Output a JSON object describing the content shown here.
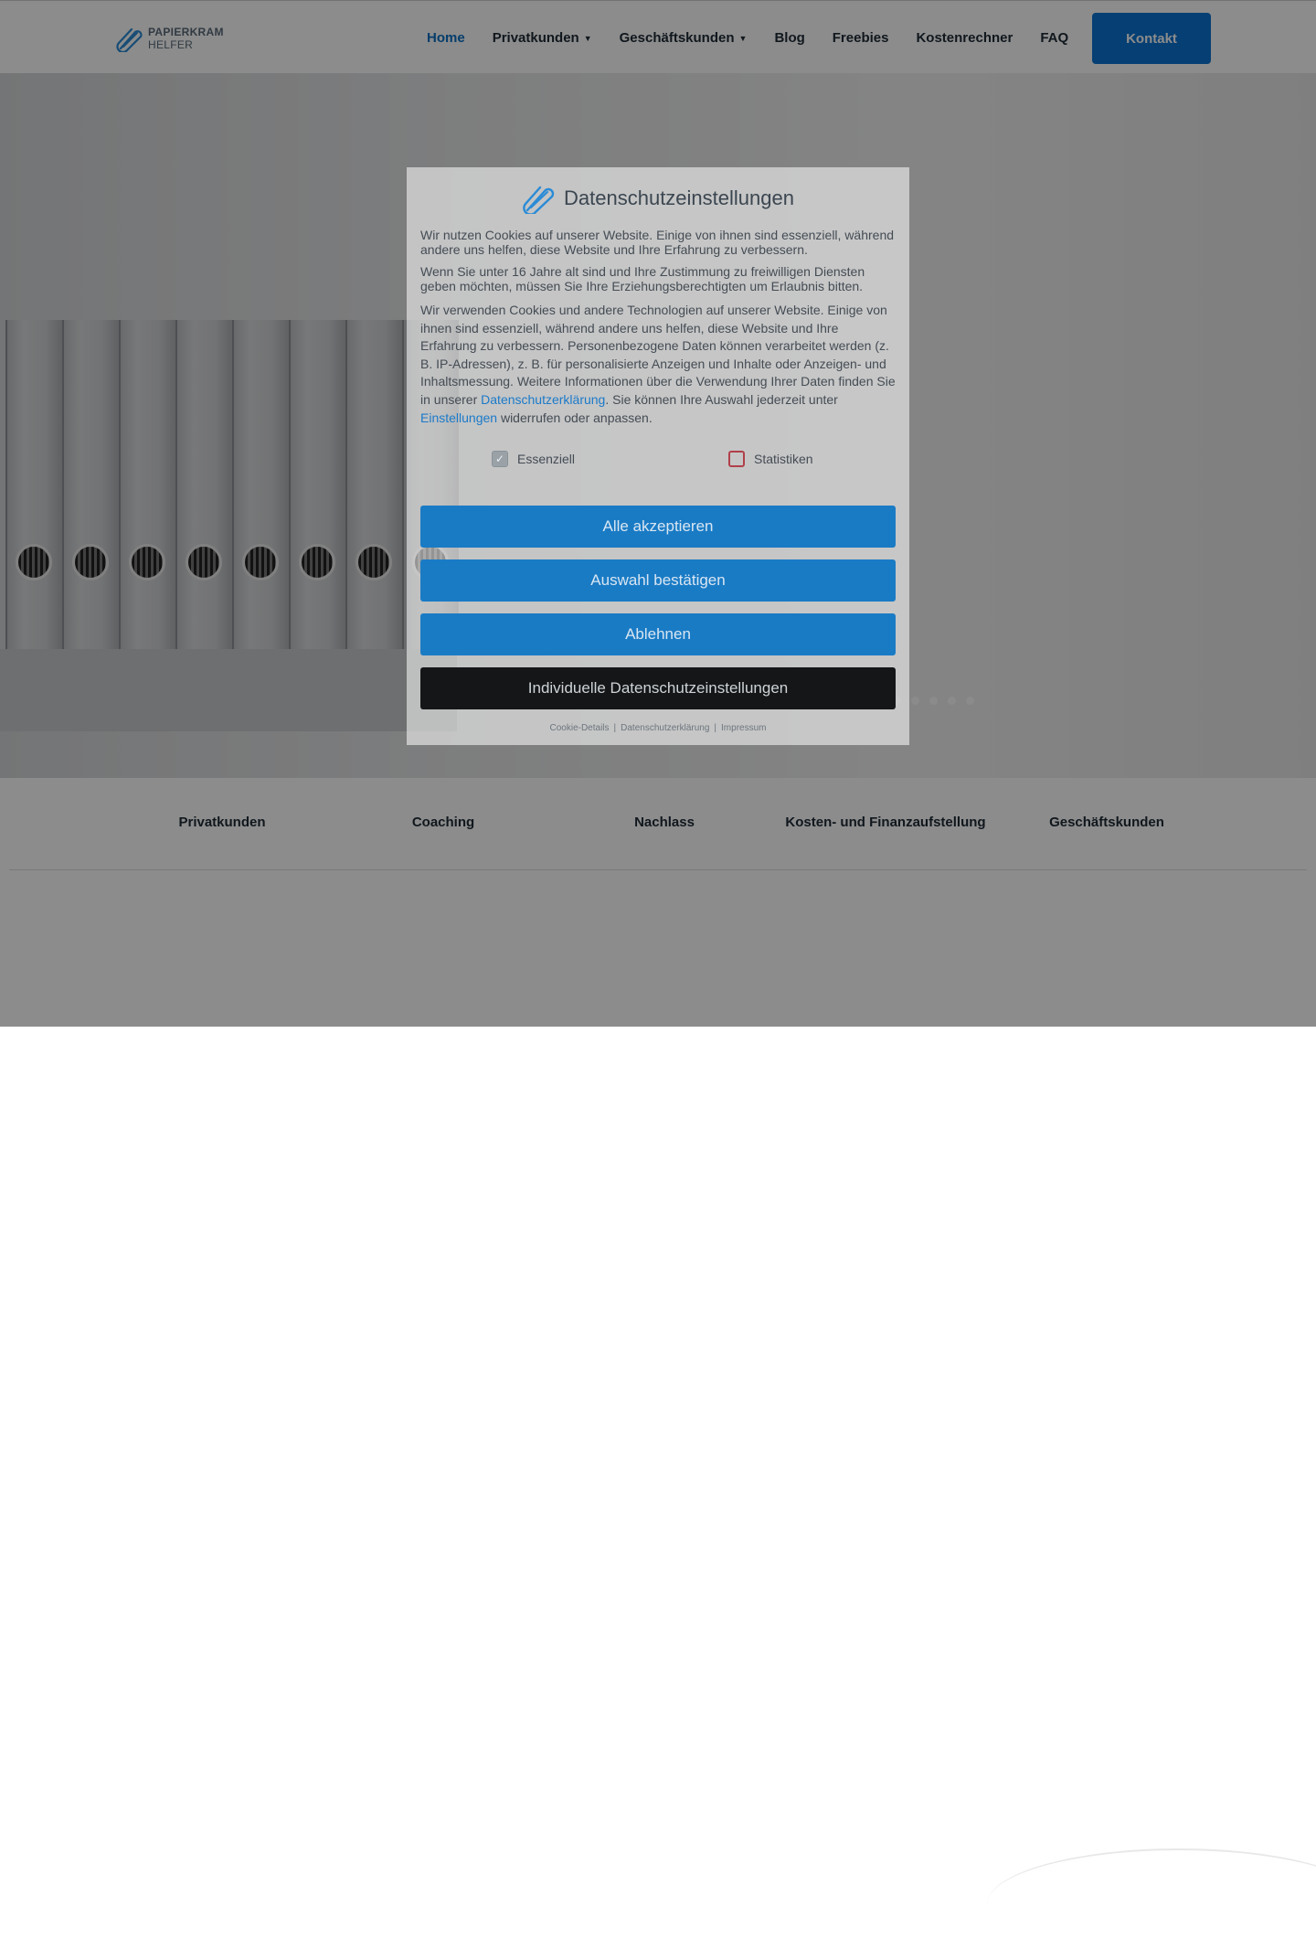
{
  "header": {
    "logo_line1": "PAPIERKRAM",
    "logo_line2": "HELFER",
    "nav": [
      {
        "label": "Home",
        "active": true,
        "dropdown": false
      },
      {
        "label": "Privatkunden",
        "active": false,
        "dropdown": true
      },
      {
        "label": "Geschäftskunden",
        "active": false,
        "dropdown": true
      },
      {
        "label": "Blog",
        "active": false,
        "dropdown": false
      },
      {
        "label": "Freebies",
        "active": false,
        "dropdown": false
      },
      {
        "label": "Kostenrechner",
        "active": false,
        "dropdown": false
      },
      {
        "label": "FAQ",
        "active": false,
        "dropdown": false
      }
    ],
    "cta": "Kontakt"
  },
  "hero": {
    "slides": 6,
    "active_slide": 1
  },
  "categories": [
    "Privatkunden",
    "Coaching",
    "Nachlass",
    "Kosten- und Finanzaufstellung",
    "Geschäftskunden"
  ],
  "cookie": {
    "title": "Datenschutzeinstellungen",
    "p1": "Wir nutzen Cookies auf unserer Website. Einige von ihnen sind essenziell, während andere uns helfen, diese Website und Ihre Erfahrung zu verbessern.",
    "p2": "Wenn Sie unter 16 Jahre alt sind und Ihre Zustimmung zu freiwilligen Diensten geben möchten, müssen Sie Ihre Erziehungsberechtigten um Erlaubnis bitten.",
    "p3_a": "Wir verwenden Cookies und andere Technologien auf unserer Website. Einige von ihnen sind essenziell, während andere uns helfen, diese Website und Ihre Erfahrung zu verbessern. Personenbezogene Daten können verarbeitet werden (z. B. IP-Adressen), z. B. für personalisierte Anzeigen und Inhalte oder Anzeigen- und Inhaltsmessung. Weitere Informationen über die Verwendung Ihrer Daten finden Sie in unserer ",
    "p3_link1": "Datenschutzerklärung",
    "p3_b": ". Sie können Ihre Auswahl jederzeit unter ",
    "p3_link2": "Einstellungen",
    "p3_c": " widerrufen oder anpassen.",
    "checkbox_essential": "Essenziell",
    "checkbox_statistics": "Statistiken",
    "essential_checked": true,
    "statistics_checked": false,
    "btn_accept_all": "Alle akzeptieren",
    "btn_confirm": "Auswahl bestätigen",
    "btn_reject": "Ablehnen",
    "btn_individual": "Individuelle Datenschutzeinstellungen",
    "footer_links": [
      "Cookie-Details",
      "Datenschutzerklärung",
      "Impressum"
    ]
  }
}
